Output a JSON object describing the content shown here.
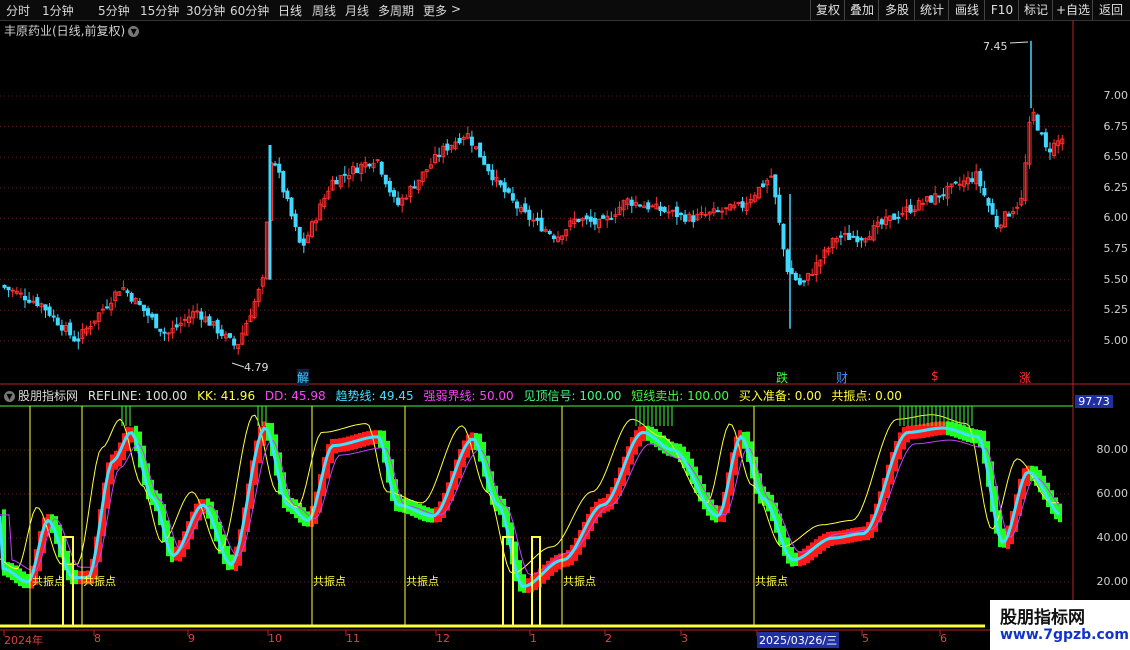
{
  "toolbar": {
    "periods": [
      "分时",
      "1分钟",
      "5分钟",
      "15分钟",
      "30分钟",
      "60分钟",
      "日线",
      "周线",
      "月线",
      "多周期",
      "更多"
    ],
    "more_arrow": ">",
    "buttons": [
      "复权",
      "叠加",
      "多股",
      "统计",
      "画线",
      "F10",
      "标记",
      "+自选",
      "返回"
    ]
  },
  "stock": {
    "title": "丰原药业(日线,前复权)",
    "toggle": "▼"
  },
  "price_panel": {
    "axis_labels": [
      "7.00",
      "6.75",
      "6.50",
      "6.25",
      "6.00",
      "5.75",
      "5.50",
      "5.25",
      "5.00"
    ],
    "high_label": "7.45",
    "low_label": "4.79",
    "markers": [
      {
        "text": "解",
        "color": "#40c8ff"
      },
      {
        "text": "跌",
        "color": "#40ff40"
      },
      {
        "text": "财",
        "color": "#4090ff"
      },
      {
        "text": "$",
        "color": "#ff3030"
      },
      {
        "text": "涨",
        "color": "#ff3030"
      }
    ]
  },
  "indicator": {
    "name": "股朋指标网",
    "values": [
      {
        "text": "REFLINE: 100.00",
        "color": "#e0e0e0"
      },
      {
        "text": "KK: 41.96",
        "color": "#ffff40"
      },
      {
        "text": "DD: 45.98",
        "color": "#ff40ff"
      },
      {
        "text": "趋势线: 49.45",
        "color": "#40e0ff"
      },
      {
        "text": "强弱界线: 50.00",
        "color": "#ff40ff"
      },
      {
        "text": "见顶信号: 100.00",
        "color": "#40ff80"
      },
      {
        "text": "短线卖出: 100.00",
        "color": "#40ff40"
      },
      {
        "text": "买入准备: 0.00",
        "color": "#ffff40"
      },
      {
        "text": "共振点: 0.00",
        "color": "#ffff40"
      }
    ],
    "current_value": "97.73",
    "axis_labels": [
      "80.00",
      "60.00",
      "40.00",
      "20.00"
    ],
    "resonance_label": "共振点"
  },
  "timeline": {
    "labels": [
      "2024年",
      "8",
      "9",
      "10",
      "11",
      "12",
      "1",
      "2",
      "3",
      "2025/03/26/三",
      "5",
      "6"
    ]
  },
  "watermark": {
    "line1": "股朋指标网",
    "line2": "www.7gpzb.com"
  },
  "colors": {
    "up": "#ff3030",
    "down": "#40d8ff",
    "bg": "#000000"
  }
}
